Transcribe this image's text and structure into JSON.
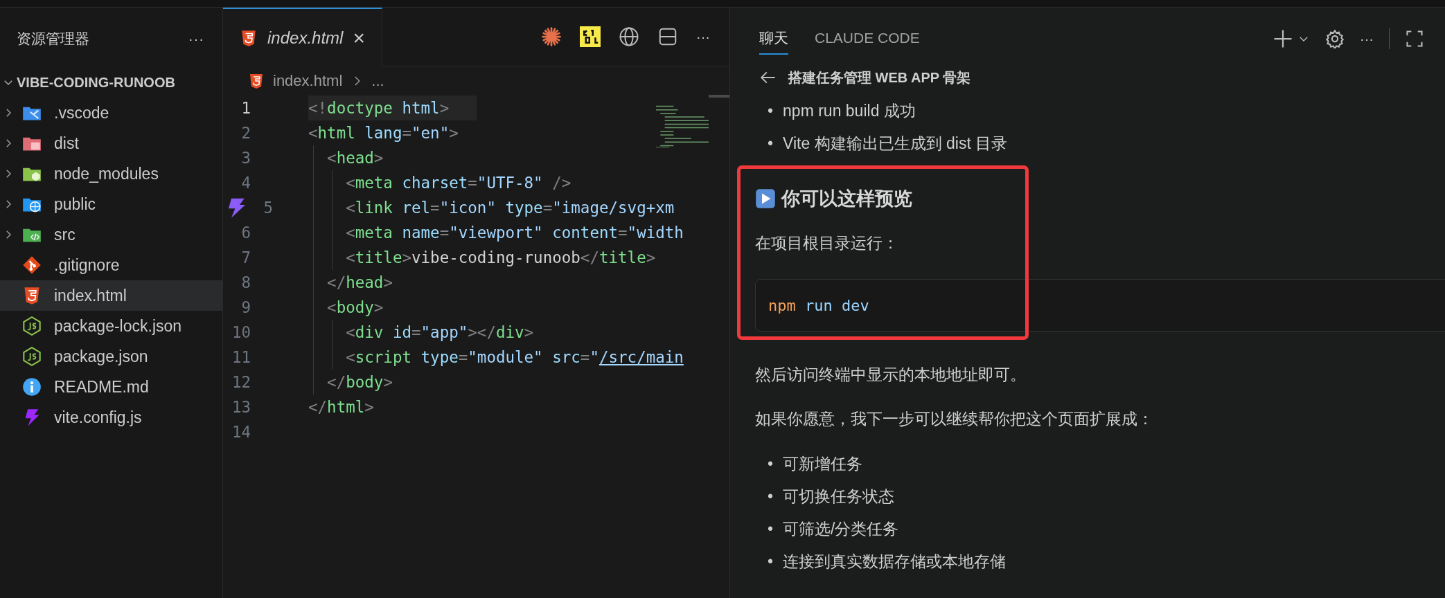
{
  "explorer": {
    "title": "资源管理器",
    "more": "···",
    "root": {
      "label": "VIBE-CODING-RUNOOB",
      "expanded": true
    },
    "items": [
      {
        "label": ".vscode",
        "kind": "vscode",
        "expanded": false,
        "selected": false
      },
      {
        "label": "dist",
        "kind": "dist",
        "expanded": false,
        "selected": false
      },
      {
        "label": "node_modules",
        "kind": "modules",
        "expanded": false,
        "selected": false
      },
      {
        "label": "public",
        "kind": "public",
        "expanded": false,
        "selected": false
      },
      {
        "label": "src",
        "kind": "src",
        "expanded": false,
        "selected": false
      },
      {
        "label": ".gitignore",
        "kind": "git",
        "selected": false
      },
      {
        "label": "index.html",
        "kind": "html",
        "selected": true
      },
      {
        "label": "package-lock.json",
        "kind": "js",
        "selected": false
      },
      {
        "label": "package.json",
        "kind": "js",
        "selected": false
      },
      {
        "label": "README.md",
        "kind": "info",
        "selected": false
      },
      {
        "label": "vite.config.js",
        "kind": "vite",
        "selected": false
      }
    ]
  },
  "editor": {
    "tab": {
      "label": "index.html",
      "close": "×",
      "selected": true
    },
    "more": "···",
    "breadcrumb": {
      "file": "index.html",
      "rest": "..."
    },
    "lines": [
      {
        "number": "1",
        "current": true,
        "decorated": false,
        "tokens": [
          {
            "kind": "punct",
            "text": "<!"
          },
          {
            "kind": "tag",
            "text": "doctype"
          },
          {
            "kind": "attr",
            "text": " html"
          },
          {
            "kind": "punct",
            "text": ">"
          }
        ]
      },
      {
        "number": "2",
        "current": false,
        "decorated": false,
        "tokens": [
          {
            "kind": "punct",
            "text": "<"
          },
          {
            "kind": "tag",
            "text": "html"
          },
          {
            "kind": "attr",
            "text": " lang"
          },
          {
            "kind": "punct",
            "text": "="
          },
          {
            "kind": "str",
            "text": "\"en\""
          },
          {
            "kind": "punct",
            "text": ">"
          }
        ]
      },
      {
        "number": "3",
        "current": false,
        "decorated": false,
        "tokens": [
          {
            "kind": "punct",
            "text": "  <"
          },
          {
            "kind": "tag",
            "text": "head"
          },
          {
            "kind": "punct",
            "text": ">"
          }
        ]
      },
      {
        "number": "4",
        "current": false,
        "decorated": false,
        "tokens": [
          {
            "kind": "punct",
            "text": "    <"
          },
          {
            "kind": "tag",
            "text": "meta"
          },
          {
            "kind": "attr",
            "text": " charset"
          },
          {
            "kind": "punct",
            "text": "="
          },
          {
            "kind": "str",
            "text": "\"UTF-8\""
          },
          {
            "kind": "punct",
            "text": " />"
          }
        ]
      },
      {
        "number": "5",
        "current": false,
        "decorated": true,
        "tokens": [
          {
            "kind": "punct",
            "text": "    <"
          },
          {
            "kind": "tag",
            "text": "link"
          },
          {
            "kind": "attr",
            "text": " rel"
          },
          {
            "kind": "punct",
            "text": "="
          },
          {
            "kind": "str",
            "text": "\"icon\""
          },
          {
            "kind": "attr",
            "text": " type"
          },
          {
            "kind": "punct",
            "text": "="
          },
          {
            "kind": "str",
            "text": "\"image/svg+xm"
          }
        ]
      },
      {
        "number": "6",
        "current": false,
        "decorated": false,
        "tokens": [
          {
            "kind": "punct",
            "text": "    <"
          },
          {
            "kind": "tag",
            "text": "meta"
          },
          {
            "kind": "attr",
            "text": " name"
          },
          {
            "kind": "punct",
            "text": "="
          },
          {
            "kind": "str",
            "text": "\"viewport\""
          },
          {
            "kind": "attr",
            "text": " content"
          },
          {
            "kind": "punct",
            "text": "="
          },
          {
            "kind": "str",
            "text": "\"width"
          }
        ]
      },
      {
        "number": "7",
        "current": false,
        "decorated": false,
        "tokens": [
          {
            "kind": "punct",
            "text": "    <"
          },
          {
            "kind": "tag",
            "text": "title"
          },
          {
            "kind": "punct",
            "text": ">"
          },
          {
            "kind": "plain",
            "text": "vibe-coding-runoob"
          },
          {
            "kind": "punct",
            "text": "</"
          },
          {
            "kind": "tag",
            "text": "title"
          },
          {
            "kind": "punct",
            "text": ">"
          }
        ]
      },
      {
        "number": "8",
        "current": false,
        "decorated": false,
        "tokens": [
          {
            "kind": "punct",
            "text": "  </"
          },
          {
            "kind": "tag",
            "text": "head"
          },
          {
            "kind": "punct",
            "text": ">"
          }
        ]
      },
      {
        "number": "9",
        "current": false,
        "decorated": false,
        "tokens": [
          {
            "kind": "punct",
            "text": "  <"
          },
          {
            "kind": "tag",
            "text": "body"
          },
          {
            "kind": "punct",
            "text": ">"
          }
        ]
      },
      {
        "number": "10",
        "current": false,
        "decorated": false,
        "tokens": [
          {
            "kind": "punct",
            "text": "    <"
          },
          {
            "kind": "tag",
            "text": "div"
          },
          {
            "kind": "attr",
            "text": " id"
          },
          {
            "kind": "punct",
            "text": "="
          },
          {
            "kind": "str",
            "text": "\"app\""
          },
          {
            "kind": "punct",
            "text": "></"
          },
          {
            "kind": "tag",
            "text": "div"
          },
          {
            "kind": "punct",
            "text": ">"
          }
        ]
      },
      {
        "number": "11",
        "current": false,
        "decorated": false,
        "tokens": [
          {
            "kind": "punct",
            "text": "    <"
          },
          {
            "kind": "tag",
            "text": "script"
          },
          {
            "kind": "attr",
            "text": " type"
          },
          {
            "kind": "punct",
            "text": "="
          },
          {
            "kind": "str",
            "text": "\"module\""
          },
          {
            "kind": "attr",
            "text": " src"
          },
          {
            "kind": "punct",
            "text": "="
          },
          {
            "kind": "str",
            "text": "\""
          },
          {
            "kind": "link",
            "text": "/src/main"
          }
        ]
      },
      {
        "number": "12",
        "current": false,
        "decorated": false,
        "tokens": [
          {
            "kind": "punct",
            "text": "  </"
          },
          {
            "kind": "tag",
            "text": "body"
          },
          {
            "kind": "punct",
            "text": ">"
          }
        ]
      },
      {
        "number": "13",
        "current": false,
        "decorated": false,
        "tokens": [
          {
            "kind": "punct",
            "text": "</"
          },
          {
            "kind": "tag",
            "text": "html"
          },
          {
            "kind": "punct",
            "text": ">"
          }
        ]
      },
      {
        "number": "14",
        "current": false,
        "decorated": false
      }
    ]
  },
  "chat": {
    "tabs": [
      {
        "label": "聊天",
        "selected": true
      },
      {
        "label": "CLAUDE CODE",
        "selected": false
      }
    ],
    "more": "···",
    "title": "搭建任务管理 WEB APP 骨架",
    "blocks": [
      {
        "kind": "list",
        "marker": "•",
        "items": [
          "npm run build 成功",
          "Vite 构建输出已生成到 dist 目录"
        ]
      },
      {
        "kind": "heading",
        "text": "你可以这样预览",
        "highlighted": true
      },
      {
        "kind": "para",
        "text": "在项目根目录运行：",
        "highlighted": true
      },
      {
        "kind": "code",
        "command": "npm",
        "args": "run dev",
        "highlighted": true
      },
      {
        "kind": "para",
        "text": "然后访问终端中显示的本地地址即可。",
        "highlighted": false
      },
      {
        "kind": "para",
        "text": "如果你愿意，我下一步可以继续帮你把这个页面扩展成：",
        "highlighted": false
      },
      {
        "kind": "list",
        "marker": "•",
        "items": [
          "可新增任务",
          "可切换任务状态",
          "可筛选/分类任务",
          "连接到真实数据存储或本地存储"
        ]
      }
    ]
  }
}
